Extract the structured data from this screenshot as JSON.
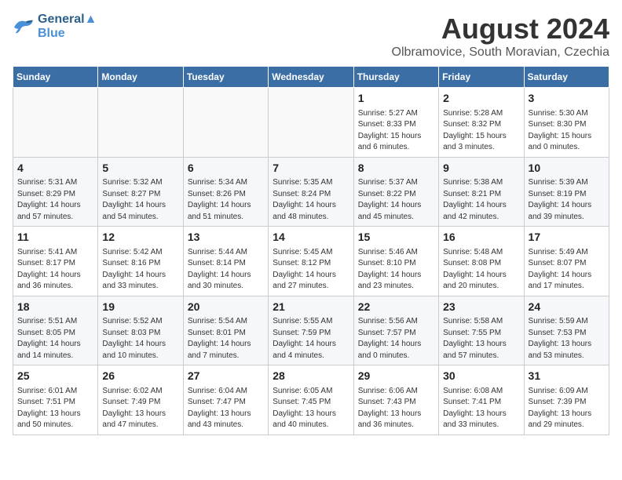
{
  "header": {
    "logo_line1": "General",
    "logo_line2": "Blue",
    "title": "August 2024",
    "subtitle": "Olbramovice, South Moravian, Czechia"
  },
  "columns": [
    "Sunday",
    "Monday",
    "Tuesday",
    "Wednesday",
    "Thursday",
    "Friday",
    "Saturday"
  ],
  "weeks": [
    [
      {
        "day": "",
        "info": ""
      },
      {
        "day": "",
        "info": ""
      },
      {
        "day": "",
        "info": ""
      },
      {
        "day": "",
        "info": ""
      },
      {
        "day": "1",
        "info": "Sunrise: 5:27 AM\nSunset: 8:33 PM\nDaylight: 15 hours\nand 6 minutes."
      },
      {
        "day": "2",
        "info": "Sunrise: 5:28 AM\nSunset: 8:32 PM\nDaylight: 15 hours\nand 3 minutes."
      },
      {
        "day": "3",
        "info": "Sunrise: 5:30 AM\nSunset: 8:30 PM\nDaylight: 15 hours\nand 0 minutes."
      }
    ],
    [
      {
        "day": "4",
        "info": "Sunrise: 5:31 AM\nSunset: 8:29 PM\nDaylight: 14 hours\nand 57 minutes."
      },
      {
        "day": "5",
        "info": "Sunrise: 5:32 AM\nSunset: 8:27 PM\nDaylight: 14 hours\nand 54 minutes."
      },
      {
        "day": "6",
        "info": "Sunrise: 5:34 AM\nSunset: 8:26 PM\nDaylight: 14 hours\nand 51 minutes."
      },
      {
        "day": "7",
        "info": "Sunrise: 5:35 AM\nSunset: 8:24 PM\nDaylight: 14 hours\nand 48 minutes."
      },
      {
        "day": "8",
        "info": "Sunrise: 5:37 AM\nSunset: 8:22 PM\nDaylight: 14 hours\nand 45 minutes."
      },
      {
        "day": "9",
        "info": "Sunrise: 5:38 AM\nSunset: 8:21 PM\nDaylight: 14 hours\nand 42 minutes."
      },
      {
        "day": "10",
        "info": "Sunrise: 5:39 AM\nSunset: 8:19 PM\nDaylight: 14 hours\nand 39 minutes."
      }
    ],
    [
      {
        "day": "11",
        "info": "Sunrise: 5:41 AM\nSunset: 8:17 PM\nDaylight: 14 hours\nand 36 minutes."
      },
      {
        "day": "12",
        "info": "Sunrise: 5:42 AM\nSunset: 8:16 PM\nDaylight: 14 hours\nand 33 minutes."
      },
      {
        "day": "13",
        "info": "Sunrise: 5:44 AM\nSunset: 8:14 PM\nDaylight: 14 hours\nand 30 minutes."
      },
      {
        "day": "14",
        "info": "Sunrise: 5:45 AM\nSunset: 8:12 PM\nDaylight: 14 hours\nand 27 minutes."
      },
      {
        "day": "15",
        "info": "Sunrise: 5:46 AM\nSunset: 8:10 PM\nDaylight: 14 hours\nand 23 minutes."
      },
      {
        "day": "16",
        "info": "Sunrise: 5:48 AM\nSunset: 8:08 PM\nDaylight: 14 hours\nand 20 minutes."
      },
      {
        "day": "17",
        "info": "Sunrise: 5:49 AM\nSunset: 8:07 PM\nDaylight: 14 hours\nand 17 minutes."
      }
    ],
    [
      {
        "day": "18",
        "info": "Sunrise: 5:51 AM\nSunset: 8:05 PM\nDaylight: 14 hours\nand 14 minutes."
      },
      {
        "day": "19",
        "info": "Sunrise: 5:52 AM\nSunset: 8:03 PM\nDaylight: 14 hours\nand 10 minutes."
      },
      {
        "day": "20",
        "info": "Sunrise: 5:54 AM\nSunset: 8:01 PM\nDaylight: 14 hours\nand 7 minutes."
      },
      {
        "day": "21",
        "info": "Sunrise: 5:55 AM\nSunset: 7:59 PM\nDaylight: 14 hours\nand 4 minutes."
      },
      {
        "day": "22",
        "info": "Sunrise: 5:56 AM\nSunset: 7:57 PM\nDaylight: 14 hours\nand 0 minutes."
      },
      {
        "day": "23",
        "info": "Sunrise: 5:58 AM\nSunset: 7:55 PM\nDaylight: 13 hours\nand 57 minutes."
      },
      {
        "day": "24",
        "info": "Sunrise: 5:59 AM\nSunset: 7:53 PM\nDaylight: 13 hours\nand 53 minutes."
      }
    ],
    [
      {
        "day": "25",
        "info": "Sunrise: 6:01 AM\nSunset: 7:51 PM\nDaylight: 13 hours\nand 50 minutes."
      },
      {
        "day": "26",
        "info": "Sunrise: 6:02 AM\nSunset: 7:49 PM\nDaylight: 13 hours\nand 47 minutes."
      },
      {
        "day": "27",
        "info": "Sunrise: 6:04 AM\nSunset: 7:47 PM\nDaylight: 13 hours\nand 43 minutes."
      },
      {
        "day": "28",
        "info": "Sunrise: 6:05 AM\nSunset: 7:45 PM\nDaylight: 13 hours\nand 40 minutes."
      },
      {
        "day": "29",
        "info": "Sunrise: 6:06 AM\nSunset: 7:43 PM\nDaylight: 13 hours\nand 36 minutes."
      },
      {
        "day": "30",
        "info": "Sunrise: 6:08 AM\nSunset: 7:41 PM\nDaylight: 13 hours\nand 33 minutes."
      },
      {
        "day": "31",
        "info": "Sunrise: 6:09 AM\nSunset: 7:39 PM\nDaylight: 13 hours\nand 29 minutes."
      }
    ]
  ]
}
